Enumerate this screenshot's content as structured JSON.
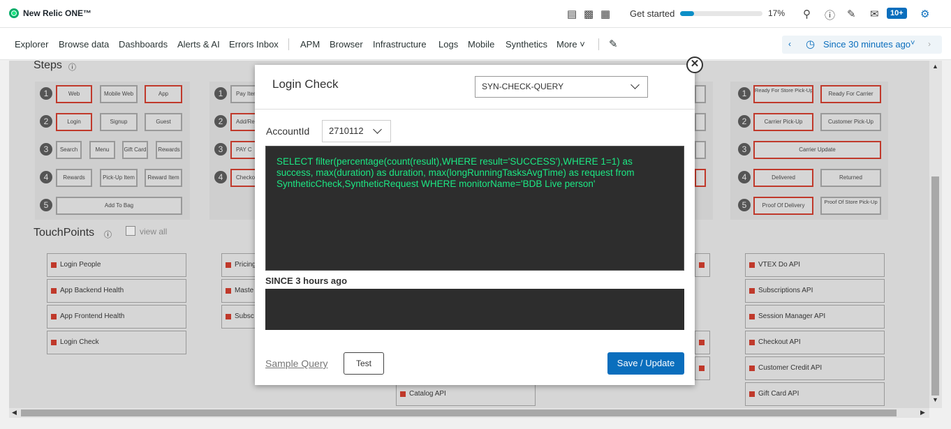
{
  "topbar": {
    "brand": "New Relic ONE™",
    "get_started": "Get started",
    "progress_pct": 0.17,
    "progress_label": "17%",
    "notifications": "10+",
    "icons": [
      "terminal-icon",
      "chart-icon",
      "apps-grid-icon",
      "search-icon",
      "help-icon",
      "feedback-icon",
      "announcements-icon",
      "user-icon"
    ]
  },
  "nav": {
    "items": [
      "Explorer",
      "Browse data",
      "Dashboards",
      "Alerts & AI",
      "Errors Inbox",
      "APM",
      "Browser",
      "Infrastructure",
      "Logs",
      "Mobile",
      "Synthetics",
      "More"
    ],
    "time_picker": "Since 30 minutes ago"
  },
  "background": {
    "steps_title": "Steps",
    "touchpoints_title": "TouchPoints",
    "view_all": "view all",
    "step_numbers": [
      "1",
      "2",
      "3",
      "4",
      "5"
    ],
    "col1": {
      "r1": [
        "Web",
        "Mobile Web",
        "App"
      ],
      "r2": [
        "Login",
        "Signup",
        "Guest"
      ],
      "r3": [
        "Search",
        "Menu",
        "Gift Card",
        "Rewards"
      ],
      "r4": [
        "Rewards",
        "Pick-Up Item",
        "Reward Item"
      ],
      "r5": "Add To Bag"
    },
    "col2": [
      "Pay Item",
      "Add/Re",
      "PAY C",
      "Checko"
    ],
    "col4": {
      "r1": [
        "Ready For Store Pick-Up",
        "Ready For Carrier"
      ],
      "r2": [
        "Carrier Pick-Up",
        "Customer Pick-Up"
      ],
      "r3": "Carrier Update",
      "r4": [
        "Delivered",
        "Returned"
      ],
      "r5": [
        "Proof Of Delivery",
        "Proof Of Store Pick-Up"
      ]
    },
    "touchpoints_col1": [
      "Login People",
      "App Backend Health",
      "App Frontend Health",
      "Login Check"
    ],
    "touchpoints_col2": [
      "Pricing",
      "Maste",
      "Subsc"
    ],
    "touchpoints_mid": "Catalog API",
    "touchpoints_col4": [
      "VTEX Do API",
      "Subscriptions API",
      "Session Manager API",
      "Checkout API",
      "Customer Credit API",
      "Gift Card API"
    ]
  },
  "modal": {
    "title": "Login Check",
    "monitor_select": "SYN-CHECK-QUERY",
    "account_label": "AccountId",
    "account_value": "2710112",
    "query": "SELECT filter(percentage(count(result),WHERE result='SUCCESS'),WHERE 1=1) as\nsuccess, max(duration) as duration, max(longRunningTasksAvgTime) as request from\nSyntheticCheck,SyntheticRequest WHERE monitorName='BDB Live person'",
    "since_label": "SINCE 3 hours ago",
    "sample_query": "Sample Query",
    "test_button": "Test",
    "save_button": "Save / Update",
    "close_symbol": "✕"
  }
}
